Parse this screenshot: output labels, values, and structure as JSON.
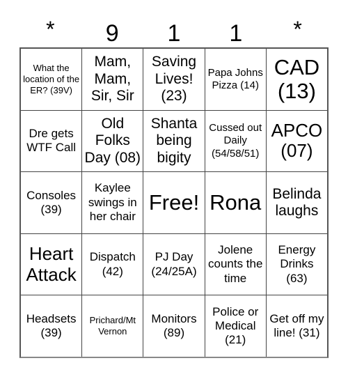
{
  "card": {
    "header": [
      {
        "label": "*",
        "is_star": true
      },
      {
        "label": "9",
        "is_star": false
      },
      {
        "label": "1",
        "is_star": false
      },
      {
        "label": "1",
        "is_star": false
      },
      {
        "label": "*",
        "is_star": true
      }
    ],
    "rows": [
      [
        {
          "text": "What the location of the ER? (39V)",
          "size": "xs"
        },
        {
          "text": "Mam, Mam, Sir, Sir",
          "size": "lg"
        },
        {
          "text": "Saving Lives! (23)",
          "size": "lg"
        },
        {
          "text": "Papa Johns Pizza (14)",
          "size": "sm"
        },
        {
          "text": "CAD (13)",
          "size": "xxl"
        }
      ],
      [
        {
          "text": "Dre gets WTF Call",
          "size": "md"
        },
        {
          "text": "Old Folks Day (08)",
          "size": "lg"
        },
        {
          "text": "Shanta being bigity",
          "size": "lg"
        },
        {
          "text": "Cussed out Daily (54/58/51)",
          "size": "sm"
        },
        {
          "text": "APCO (07)",
          "size": "xl"
        }
      ],
      [
        {
          "text": "Consoles (39)",
          "size": "md"
        },
        {
          "text": "Kaylee swings in her chair",
          "size": "md"
        },
        {
          "text": "Free!",
          "size": "xxl"
        },
        {
          "text": "Rona",
          "size": "xxl"
        },
        {
          "text": "Belinda laughs",
          "size": "lg"
        }
      ],
      [
        {
          "text": "Heart Attack",
          "size": "xl"
        },
        {
          "text": "Dispatch (42)",
          "size": "md"
        },
        {
          "text": "PJ Day (24/25A)",
          "size": "md"
        },
        {
          "text": "Jolene counts the time",
          "size": "md"
        },
        {
          "text": "Energy Drinks (63)",
          "size": "md"
        }
      ],
      [
        {
          "text": "Headsets (39)",
          "size": "md"
        },
        {
          "text": "Prichard/Mt Vernon",
          "size": "xs"
        },
        {
          "text": "Monitors (89)",
          "size": "md"
        },
        {
          "text": "Police or Medical (21)",
          "size": "md"
        },
        {
          "text": "Get off my line! (31)",
          "size": "md"
        }
      ]
    ],
    "free_space": {
      "row": 2,
      "col": 2,
      "label": "Free!"
    },
    "colors": {
      "background": "#ffffff",
      "text": "#000000",
      "grid_line": "#444444",
      "grid_border": "#555555"
    }
  }
}
